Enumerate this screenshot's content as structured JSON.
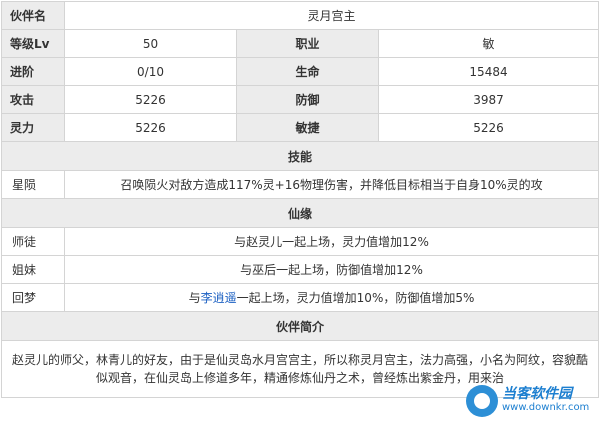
{
  "basic": {
    "name_label": "伙伴名",
    "name_value": "灵月宫主",
    "level_label": "等级Lv",
    "level_value": "50",
    "class_label": "职业",
    "class_value": "敏",
    "advance_label": "进阶",
    "advance_value": "0/10",
    "hp_label": "生命",
    "hp_value": "15484",
    "attack_label": "攻击",
    "attack_value": "5226",
    "defense_label": "防御",
    "defense_value": "3987",
    "spirit_label": "灵力",
    "spirit_value": "5226",
    "agility_label": "敏捷",
    "agility_value": "5226"
  },
  "skills": {
    "header": "技能",
    "items": [
      {
        "name": "星陨",
        "desc": "召唤陨火对敌方造成117%灵+16物理伤害，并降低目标相当于自身10%灵的攻"
      }
    ]
  },
  "fate": {
    "header": "仙缘",
    "items": [
      {
        "name": "师徒",
        "desc_pre": "与赵灵儿一起上场，灵力值增加12%",
        "link": "",
        "desc_post": ""
      },
      {
        "name": "姐妹",
        "desc_pre": "与巫后一起上场，防御值增加12%",
        "link": "",
        "desc_post": ""
      },
      {
        "name": "回梦",
        "desc_pre": "与",
        "link": "李逍遥",
        "desc_post": "一起上场，灵力值增加10%，防御值增加5%"
      }
    ]
  },
  "intro": {
    "header": "伙伴简介",
    "text": "赵灵儿的师父，林青儿的好友，由于是仙灵岛水月宫宫主，所以称灵月宫主，法力高强，小名为阿纹，容貌酷似观音，在仙灵岛上修道多年，精通修炼仙丹之术，曾经炼出紫金丹，用来治"
  },
  "watermark": {
    "title": "当客软件园",
    "url": "www.downkr.com",
    "accent": "#1d7fd0"
  }
}
